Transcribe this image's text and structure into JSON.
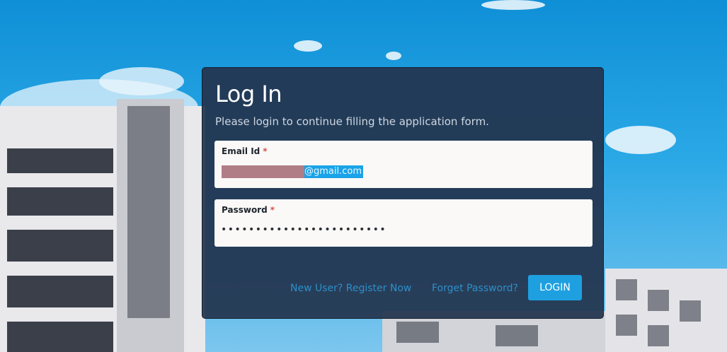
{
  "login": {
    "title": "Log In",
    "subtitle": "Please login to continue filling the application form.",
    "email": {
      "label": "Email Id",
      "required_marker": "*",
      "visible_value_suffix": "@gmail.com"
    },
    "password": {
      "label": "Password",
      "required_marker": "*",
      "masked_value": "••••••••••••••••••••••••"
    },
    "links": {
      "register": "New User? Register Now",
      "forgot": "Forget Password?"
    },
    "login_button": "LOGIN"
  },
  "colors": {
    "card_bg": "#22344e",
    "accent": "#1ea0e0",
    "link": "#2d8fc9",
    "required": "#d9534f"
  }
}
